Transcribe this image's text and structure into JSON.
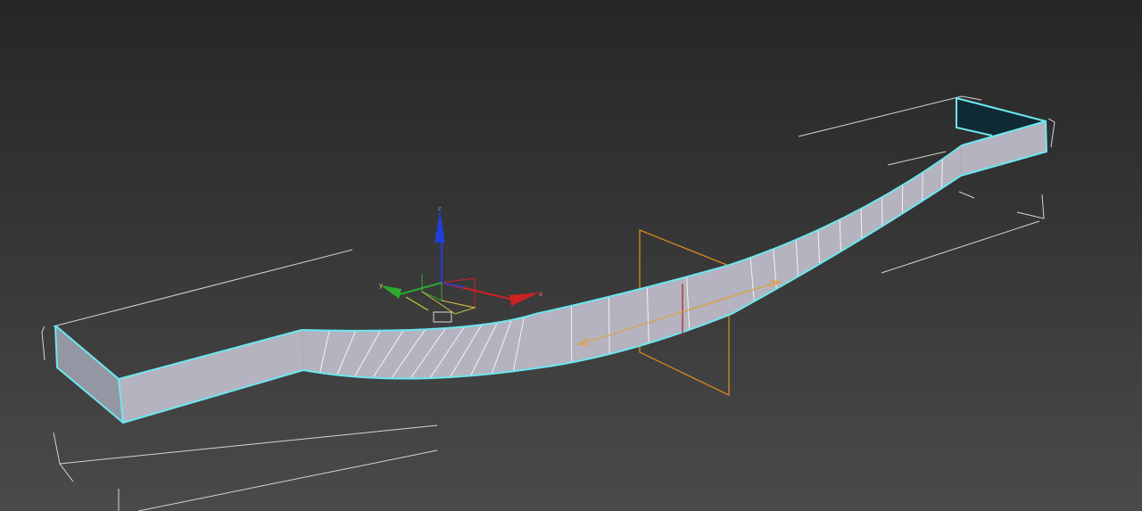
{
  "viewport": {
    "name": "perspective-viewport",
    "background_top": "#262626",
    "background_bottom": "#4a4a4a"
  },
  "object": {
    "name": "bent-box-mesh",
    "face_color": "#b4b3bf",
    "end_cap_color": "#0f2a33",
    "selection_edge_color": "#6ee7f0"
  },
  "gizmo": {
    "type": "move-transform-gizmo",
    "x_axis_color": "#cc2222",
    "y_axis_color": "#2ea82e",
    "z_axis_color": "#1f3fd6",
    "x_label": "x",
    "y_label": "y",
    "z_label": "z"
  },
  "bend_modifier": {
    "name": "bend-gizmo",
    "color": "#d9871f"
  }
}
